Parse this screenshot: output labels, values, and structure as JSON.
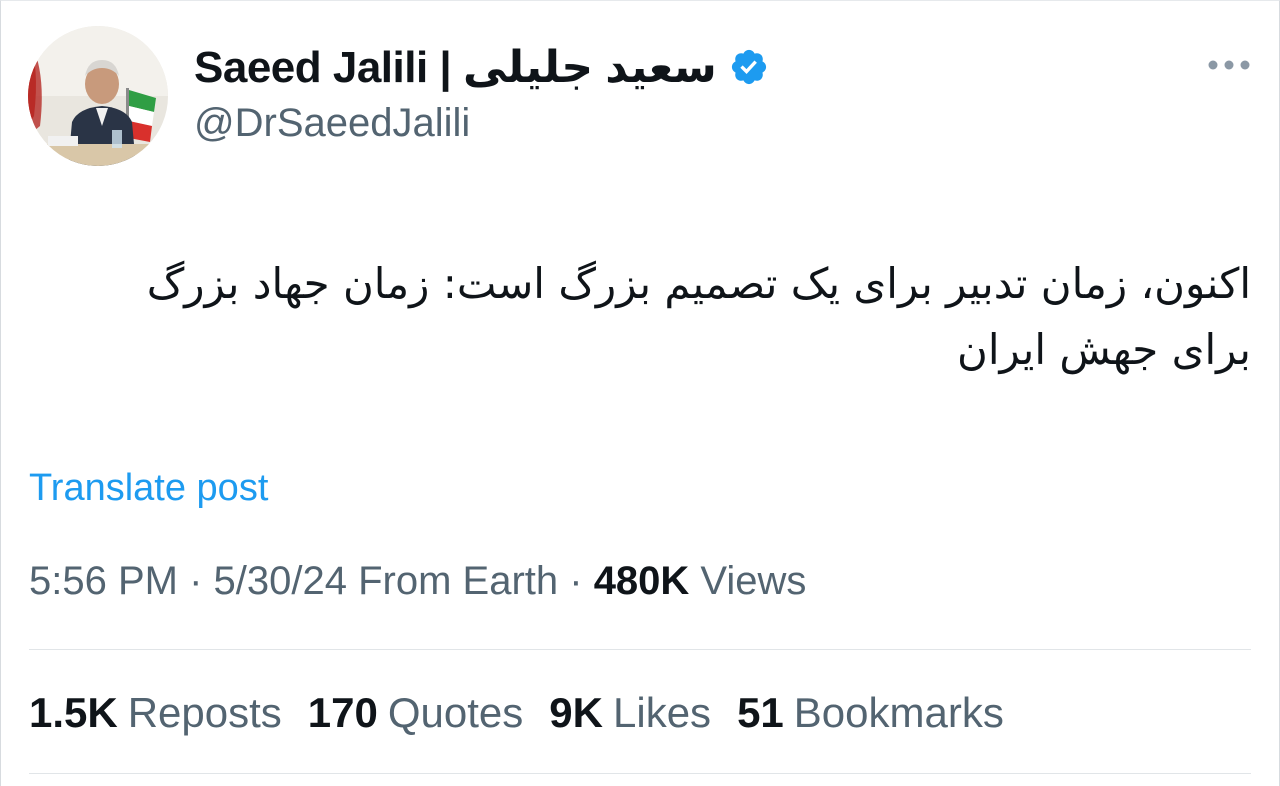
{
  "author": {
    "display_name": "Saeed Jalili | سعید جلیلی",
    "handle": "@DrSaeedJalili",
    "verified_icon": "verified-badge-icon",
    "avatar": "profile-photo"
  },
  "menu": {
    "more_icon": "more-options-icon"
  },
  "post": {
    "text": "اکنون، زمان تدبیر برای یک تصمیم بزرگ است: زمان جهاد بزرگ برای جهش ایران",
    "translate_label": "Translate post"
  },
  "meta": {
    "time": "5:56 PM",
    "sep1": " · ",
    "date": "5/30/24",
    "source": " From Earth",
    "sep2": " · ",
    "views_count": "480K",
    "views_label": " Views"
  },
  "stats": [
    {
      "count": "1.5K",
      "label": "Reposts"
    },
    {
      "count": "170",
      "label": "Quotes"
    },
    {
      "count": "9K",
      "label": "Likes"
    },
    {
      "count": "51",
      "label": "Bookmarks"
    }
  ],
  "colors": {
    "link": "#1d9bf0",
    "secondary_text": "#536471",
    "primary_text": "#0f1419"
  }
}
